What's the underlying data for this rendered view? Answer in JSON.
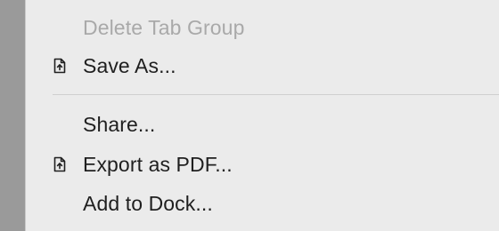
{
  "menu": {
    "items": [
      {
        "label": "Delete Tab Group",
        "enabled": false,
        "icon": null
      },
      {
        "label": "Save As...",
        "enabled": true,
        "icon": "document-arrow-up-icon"
      },
      {
        "label": "Share...",
        "enabled": true,
        "icon": null
      },
      {
        "label": "Export as PDF...",
        "enabled": true,
        "icon": "document-arrow-up-icon"
      },
      {
        "label": "Add to Dock...",
        "enabled": true,
        "icon": null
      }
    ]
  },
  "colors": {
    "menu_background": "#ebebeb",
    "text": "#1f1f1f",
    "disabled_text": "#a9a9a9",
    "separator": "#cfcfcf",
    "backdrop": "#9a9a9a"
  }
}
